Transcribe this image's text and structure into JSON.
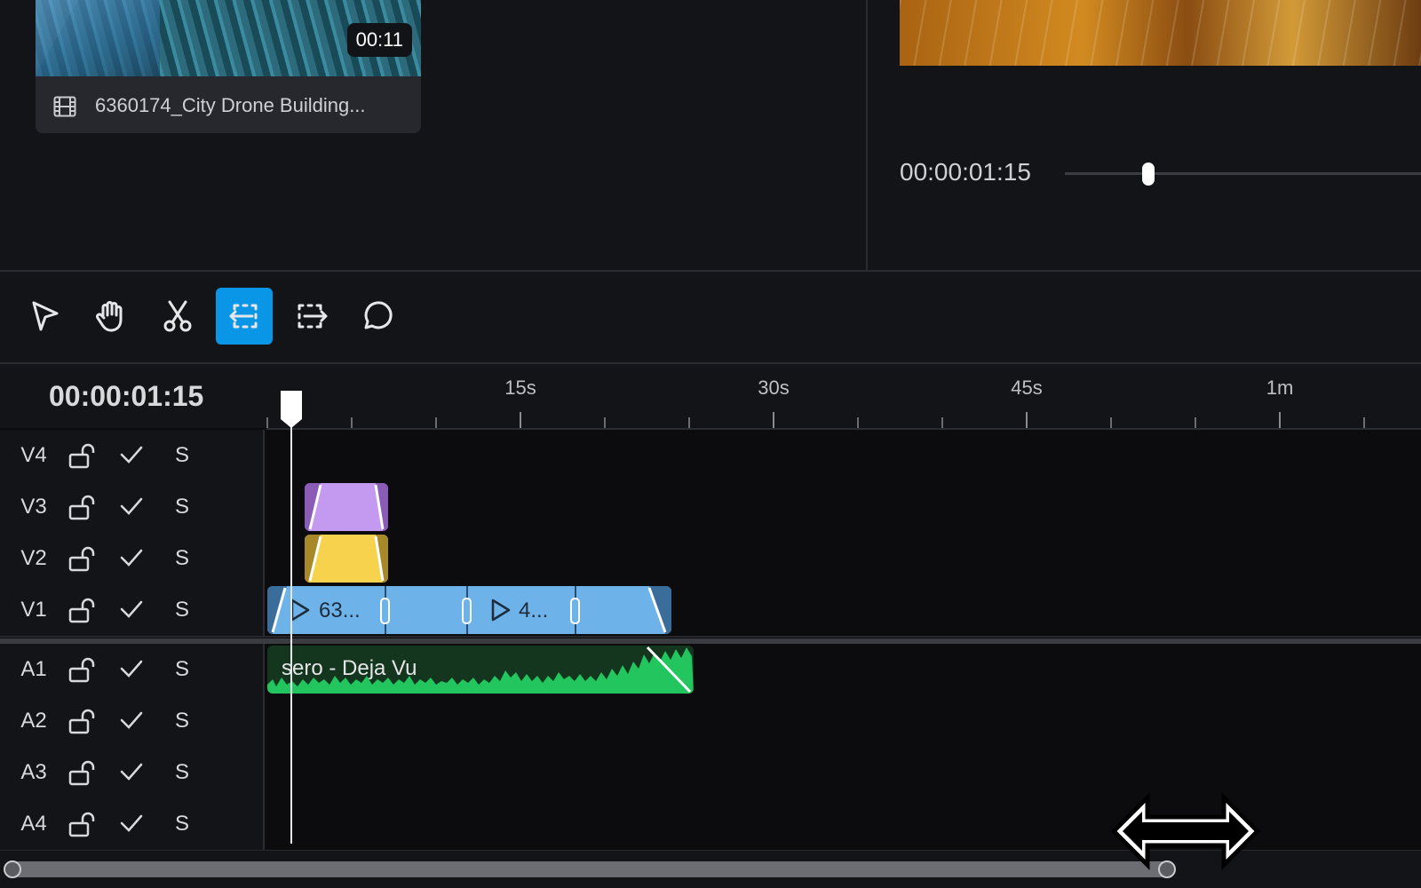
{
  "media": {
    "duration": "00:11",
    "file_name": "6360174_City Drone Building...",
    "icon": "film-icon"
  },
  "preview": {
    "timecode": "00:00:01:15",
    "scrubber_progress": 0.24
  },
  "toolbar": {
    "tools": [
      {
        "name": "select",
        "icon": "pointer-icon",
        "active": false
      },
      {
        "name": "hand",
        "icon": "hand-icon",
        "active": false
      },
      {
        "name": "cut",
        "icon": "scissors-icon",
        "active": false
      },
      {
        "name": "ripple-left",
        "icon": "trim-left-icon",
        "active": true
      },
      {
        "name": "ripple-right",
        "icon": "trim-right-icon",
        "active": false
      },
      {
        "name": "comment",
        "icon": "comment-icon",
        "active": false
      }
    ],
    "active_color": "#0A96E6"
  },
  "timeline": {
    "timecode": "00:00:01:15",
    "ruler_labels": [
      "15s",
      "30s",
      "45s",
      "1m"
    ],
    "tracks": [
      {
        "name": "V4",
        "solo": "S"
      },
      {
        "name": "V3",
        "solo": "S"
      },
      {
        "name": "V2",
        "solo": "S"
      },
      {
        "name": "V1",
        "solo": "S"
      },
      {
        "name": "A1",
        "solo": "S"
      },
      {
        "name": "A2",
        "solo": "S"
      },
      {
        "name": "A3",
        "solo": "S"
      },
      {
        "name": "A4",
        "solo": "S"
      }
    ],
    "clips": {
      "v3_color": "#C499F0",
      "v2_color": "#F7D24C",
      "v1_color": "#6DB3EA",
      "v1_label_1": "63...",
      "v1_label_2": "4...",
      "a1_label": "sero - Deja Vu",
      "a1_wave_color": "#22C55E"
    }
  }
}
